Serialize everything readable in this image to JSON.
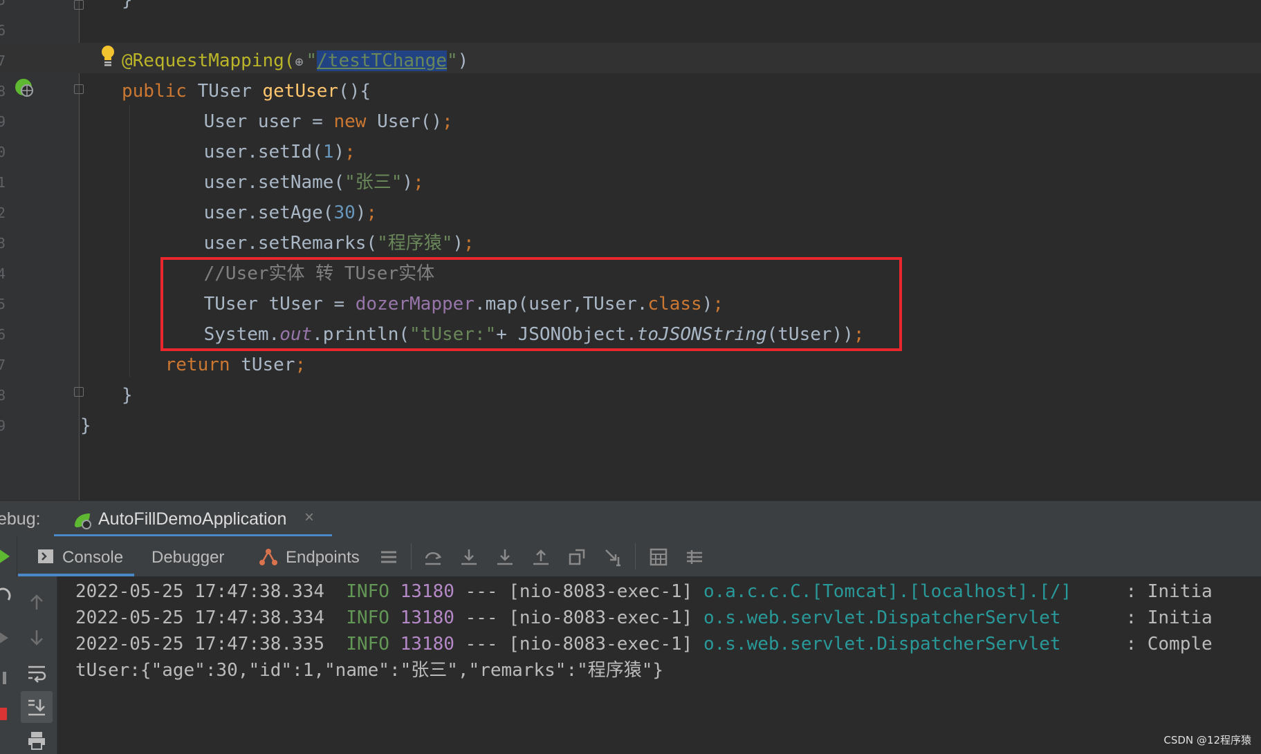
{
  "editor": {
    "line_numbers": [
      "5",
      "6",
      "7",
      "8",
      "9",
      "0",
      "1",
      "2",
      "3",
      "4",
      "5",
      "6",
      "7",
      "8",
      "9"
    ],
    "lines": [
      {
        "tokens": [
          {
            "c": "}",
            "t": ""
          }
        ]
      },
      {
        "tokens": []
      },
      {
        "tokens": [
          {
            "c": "@RequestMapping(",
            "t": "ann"
          },
          {
            "c": "⊕",
            "t": "globe"
          },
          {
            "c": "\"",
            "t": "str"
          },
          {
            "c": "/testTChange",
            "t": "link"
          },
          {
            "c": "\"",
            "t": "str"
          },
          {
            "c": ")",
            "t": ""
          }
        ]
      },
      {
        "tokens": [
          {
            "c": "public ",
            "t": "kw"
          },
          {
            "c": "TUser ",
            "t": ""
          },
          {
            "c": "getUser",
            "t": "fn"
          },
          {
            "c": "(){",
            "t": ""
          }
        ]
      },
      {
        "tokens": [
          {
            "c": "    User user = ",
            "t": ""
          },
          {
            "c": "new ",
            "t": "kw"
          },
          {
            "c": "User()",
            "t": ""
          },
          {
            "c": ";",
            "t": "kw"
          }
        ]
      },
      {
        "tokens": [
          {
            "c": "    user.setId(",
            "t": ""
          },
          {
            "c": "1",
            "t": "num"
          },
          {
            "c": ")",
            "t": ""
          },
          {
            "c": ";",
            "t": "kw"
          }
        ]
      },
      {
        "tokens": [
          {
            "c": "    user.setName(",
            "t": ""
          },
          {
            "c": "\"张三\"",
            "t": "str"
          },
          {
            "c": ")",
            "t": ""
          },
          {
            "c": ";",
            "t": "kw"
          }
        ]
      },
      {
        "tokens": [
          {
            "c": "    user.setAge(",
            "t": ""
          },
          {
            "c": "30",
            "t": "num"
          },
          {
            "c": ")",
            "t": ""
          },
          {
            "c": ";",
            "t": "kw"
          }
        ]
      },
      {
        "tokens": [
          {
            "c": "    user.setRemarks(",
            "t": ""
          },
          {
            "c": "\"程序猿\"",
            "t": "str"
          },
          {
            "c": ")",
            "t": ""
          },
          {
            "c": ";",
            "t": "kw"
          }
        ]
      },
      {
        "tokens": [
          {
            "c": "    //User实体 转 TUser实体",
            "t": "cmt"
          }
        ]
      },
      {
        "tokens": [
          {
            "c": "    TUser tUser = ",
            "t": ""
          },
          {
            "c": "dozerMapper",
            "t": "field"
          },
          {
            "c": ".map(user,TUser.",
            "t": ""
          },
          {
            "c": "class",
            "t": "kw"
          },
          {
            "c": ")",
            "t": ""
          },
          {
            "c": ";",
            "t": "kw"
          }
        ]
      },
      {
        "tokens": [
          {
            "c": "    System.",
            "t": ""
          },
          {
            "c": "out",
            "t": "static"
          },
          {
            "c": ".println(",
            "t": ""
          },
          {
            "c": "\"tUser:\"",
            "t": "str"
          },
          {
            "c": "+ JSONObject.",
            "t": ""
          },
          {
            "c": "toJSONString",
            "t": "italic"
          },
          {
            "c": "(tUser))",
            "t": ""
          },
          {
            "c": ";",
            "t": "kw"
          }
        ]
      },
      {
        "tokens": [
          {
            "c": "    ",
            "t": ""
          },
          {
            "c": "return ",
            "t": "kw"
          },
          {
            "c": "tUser",
            "t": ""
          },
          {
            "c": ";",
            "t": "kw"
          }
        ]
      },
      {
        "tokens": [
          {
            "c": "}",
            "t": ""
          }
        ]
      },
      {
        "tokens": [
          {
            "c": "}",
            "t": ""
          }
        ]
      }
    ],
    "highlight_color": "#e8272f"
  },
  "debug": {
    "label": "ebug:",
    "tab_label": "AutoFillDemoApplication",
    "tab_close": "×",
    "tab_icon": "spring-run-icon",
    "tabs": {
      "console": "Console",
      "debugger": "Debugger",
      "endpoints": "Endpoints"
    }
  },
  "console": {
    "lines": [
      {
        "date": "2022-05-25 17:47:38.334",
        "level": "INFO",
        "pid": "13180",
        "sep": "---",
        "thread": "[nio-8083-exec-1]",
        "logger": "o.a.c.c.C.[Tomcat].[localhost].[/]",
        "msg": "    : Initia"
      },
      {
        "date": "2022-05-25 17:47:38.334",
        "level": "INFO",
        "pid": "13180",
        "sep": "---",
        "thread": "[nio-8083-exec-1]",
        "logger": "o.s.web.servlet.DispatcherServlet",
        "msg": "     : Initia"
      },
      {
        "date": "2022-05-25 17:47:38.335",
        "level": "INFO",
        "pid": "13180",
        "sep": "---",
        "thread": "[nio-8083-exec-1]",
        "logger": "o.s.web.servlet.DispatcherServlet",
        "msg": "     : Comple"
      }
    ],
    "output": "tUser:{\"age\":30,\"id\":1,\"name\":\"张三\",\"remarks\":\"程序猿\"}"
  },
  "watermark": "CSDN @12程序猿"
}
